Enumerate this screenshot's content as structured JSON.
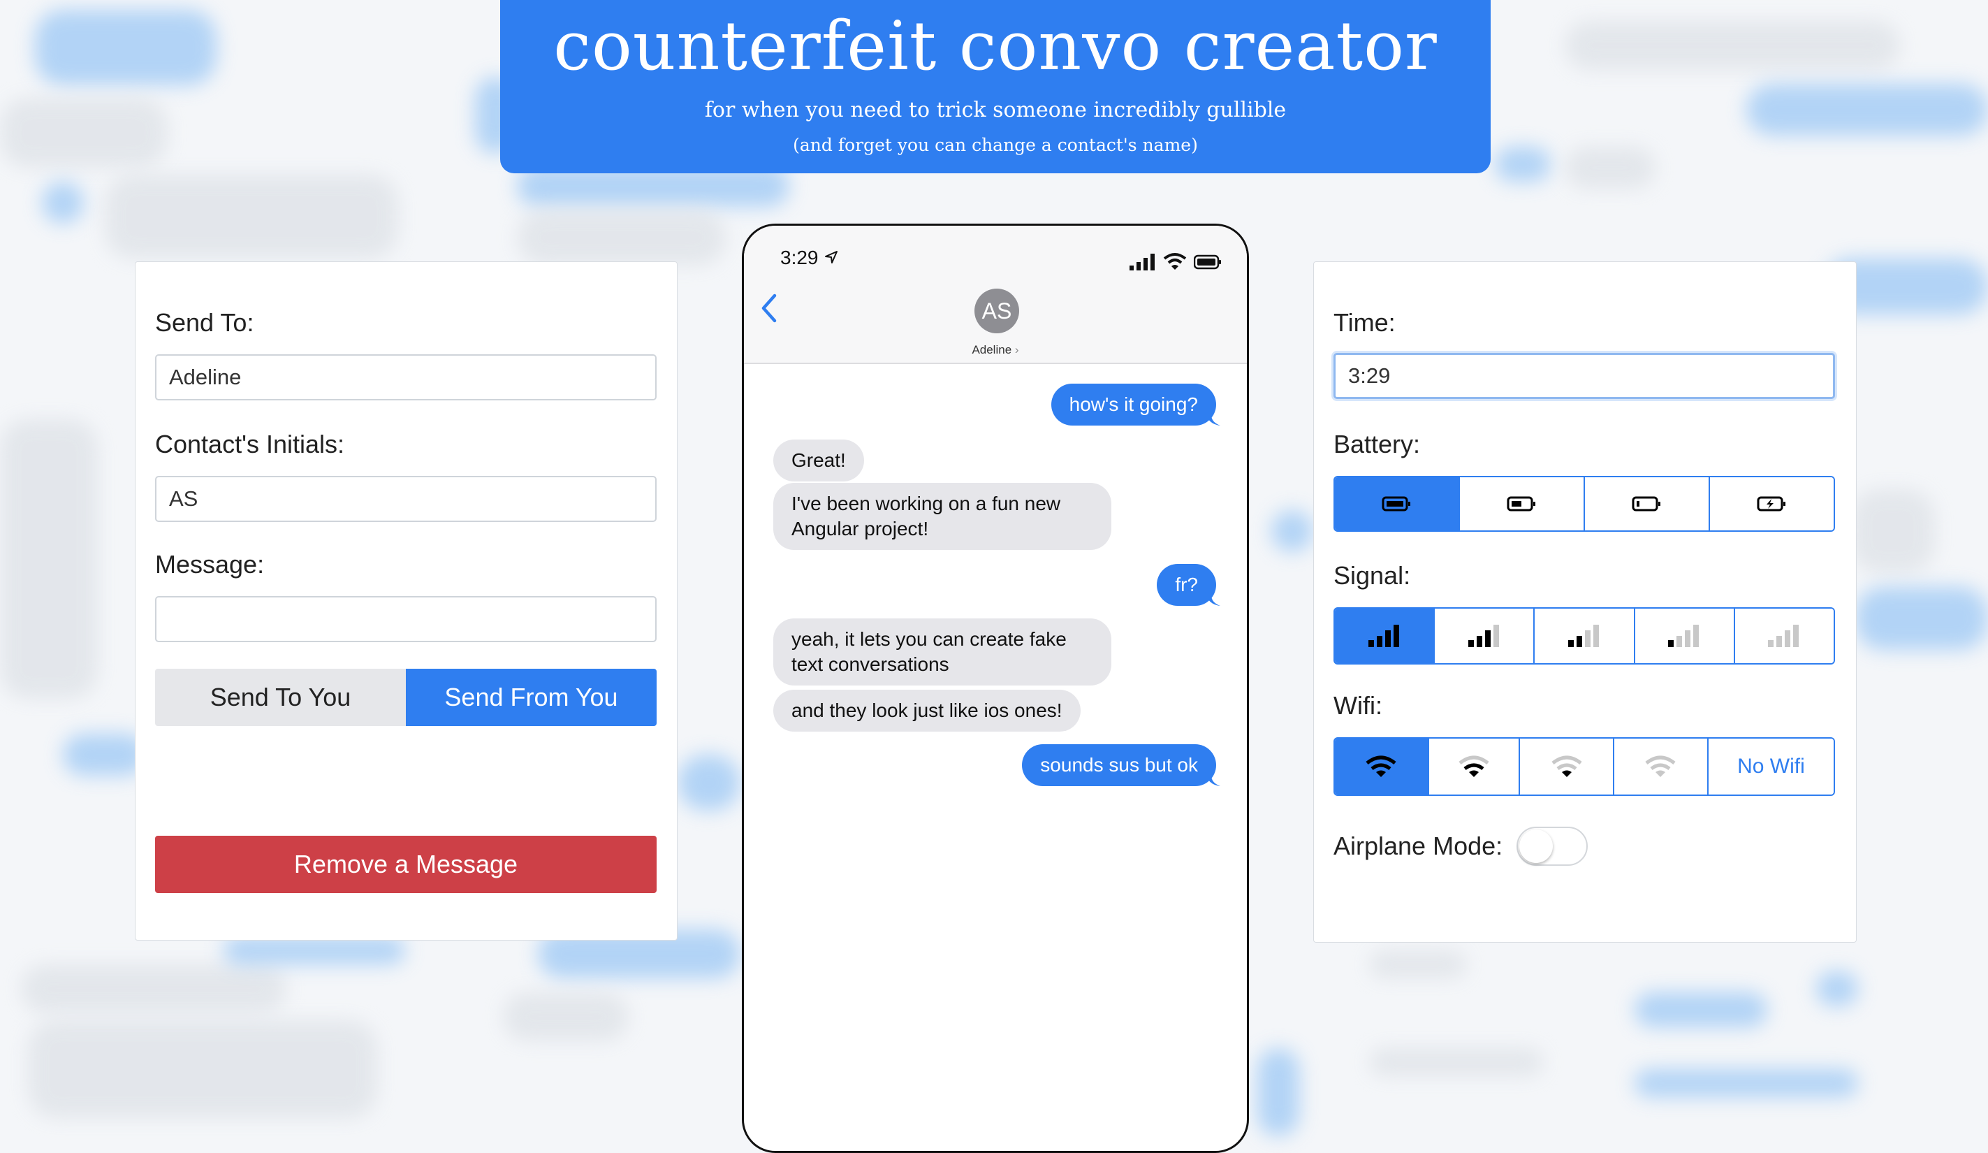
{
  "header": {
    "title": "counterfeit convo creator",
    "subtitle": "for when you need to trick someone incredibly gullible",
    "note": "(and forget you can change a contact's name)"
  },
  "compose": {
    "send_to_label": "Send To:",
    "send_to_value": "Adeline",
    "initials_label": "Contact's Initials:",
    "initials_value": "AS",
    "message_label": "Message:",
    "message_value": "",
    "send_to_you": "Send To You",
    "send_from_you": "Send From You",
    "remove_message": "Remove a Message"
  },
  "phone": {
    "time": "3:29",
    "initials": "AS",
    "contact": "Adeline",
    "messages": [
      {
        "from": "me",
        "text": "how's it going?"
      },
      {
        "from": "them",
        "text": "Great!"
      },
      {
        "from": "them",
        "text": "I've been working on a fun new Angular project!"
      },
      {
        "from": "me",
        "text": "fr?"
      },
      {
        "from": "them",
        "text": "yeah, it lets you can create fake text conversations"
      },
      {
        "from": "them",
        "text": "and they look just like ios ones!"
      },
      {
        "from": "me",
        "text": "sounds sus but ok"
      }
    ]
  },
  "settings": {
    "time_label": "Time:",
    "time_value": "3:29",
    "battery_label": "Battery:",
    "battery_options": [
      "battery-full-icon",
      "battery-half-icon",
      "battery-low-icon",
      "battery-charging-icon"
    ],
    "battery_selected": 0,
    "signal_label": "Signal:",
    "signal_options": [
      "signal-4-bars-icon",
      "signal-3-bars-icon",
      "signal-2-bars-icon",
      "signal-1-bar-icon",
      "signal-0-bars-icon"
    ],
    "signal_selected": 0,
    "wifi_label": "Wifi:",
    "wifi_options": [
      "wifi-3-bars-icon",
      "wifi-2-bars-icon",
      "wifi-1-bar-icon",
      "wifi-0-bars-icon"
    ],
    "wifi_no_wifi": "No Wifi",
    "wifi_selected": 0,
    "airplane_label": "Airplane Mode:",
    "airplane_on": false
  },
  "colors": {
    "accent": "#2f7ef0",
    "danger": "#cd4047",
    "bubble_in": "#e6e6ea"
  }
}
